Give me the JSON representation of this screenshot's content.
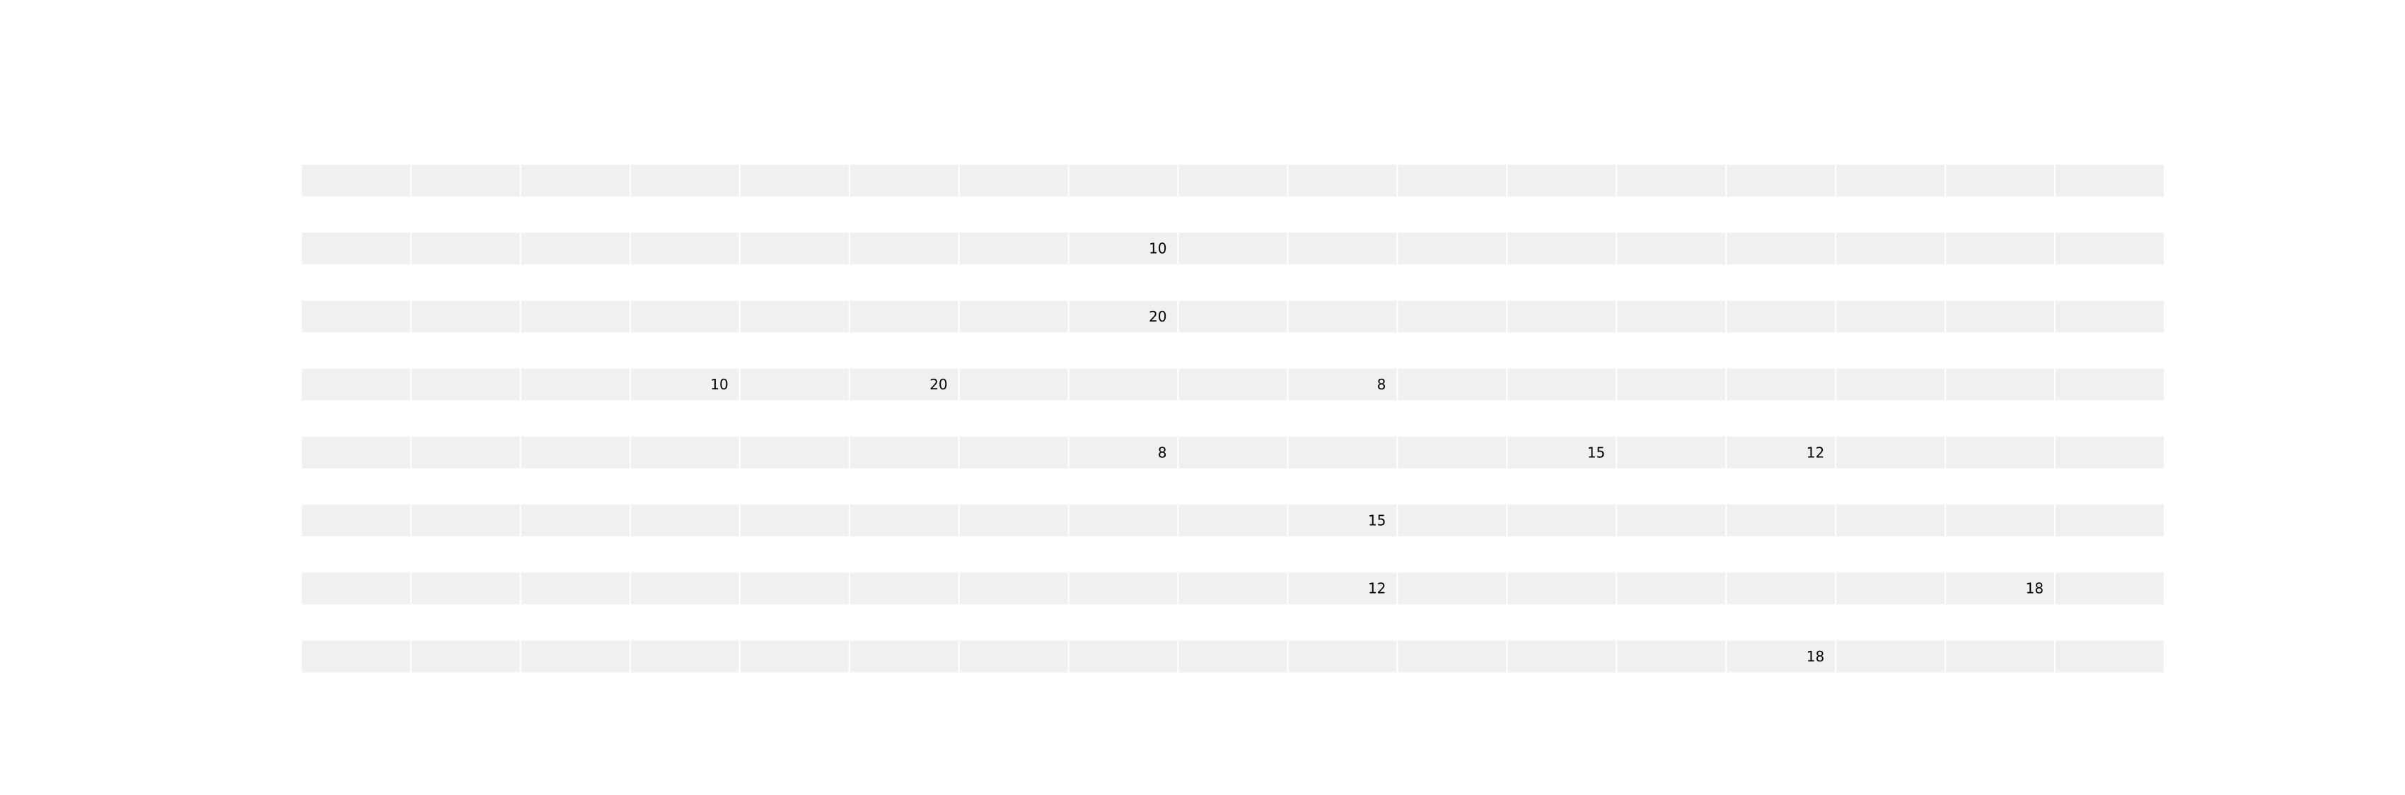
{
  "chart_data": {
    "type": "table",
    "title": "",
    "xlabel": "",
    "ylabel": "",
    "n_rows": 8,
    "n_cols": 17,
    "row_fill": "#f0f0f0",
    "separator_color": "#ffffff",
    "text_color": "#000000",
    "rows": [
      [
        "",
        "",
        "",
        "",
        "",
        "",
        "",
        "",
        "",
        "",
        "",
        "",
        "",
        "",
        "",
        "",
        ""
      ],
      [
        "",
        "",
        "",
        "",
        "",
        "",
        "",
        "10",
        "",
        "",
        "",
        "",
        "",
        "",
        "",
        "",
        ""
      ],
      [
        "",
        "",
        "",
        "",
        "",
        "",
        "",
        "20",
        "",
        "",
        "",
        "",
        "",
        "",
        "",
        "",
        ""
      ],
      [
        "",
        "",
        "",
        "10",
        "",
        "20",
        "",
        "",
        "",
        "8",
        "",
        "",
        "",
        "",
        "",
        "",
        ""
      ],
      [
        "",
        "",
        "",
        "",
        "",
        "",
        "",
        "8",
        "",
        "",
        "",
        "15",
        "",
        "12",
        "",
        "",
        ""
      ],
      [
        "",
        "",
        "",
        "",
        "",
        "",
        "",
        "",
        "",
        "15",
        "",
        "",
        "",
        "",
        "",
        "",
        ""
      ],
      [
        "",
        "",
        "",
        "",
        "",
        "",
        "",
        "",
        "",
        "12",
        "",
        "",
        "",
        "",
        "",
        "18",
        ""
      ],
      [
        "",
        "",
        "",
        "",
        "",
        "",
        "",
        "",
        "",
        "",
        "",
        "",
        "",
        "18",
        "",
        "",
        ""
      ]
    ]
  }
}
